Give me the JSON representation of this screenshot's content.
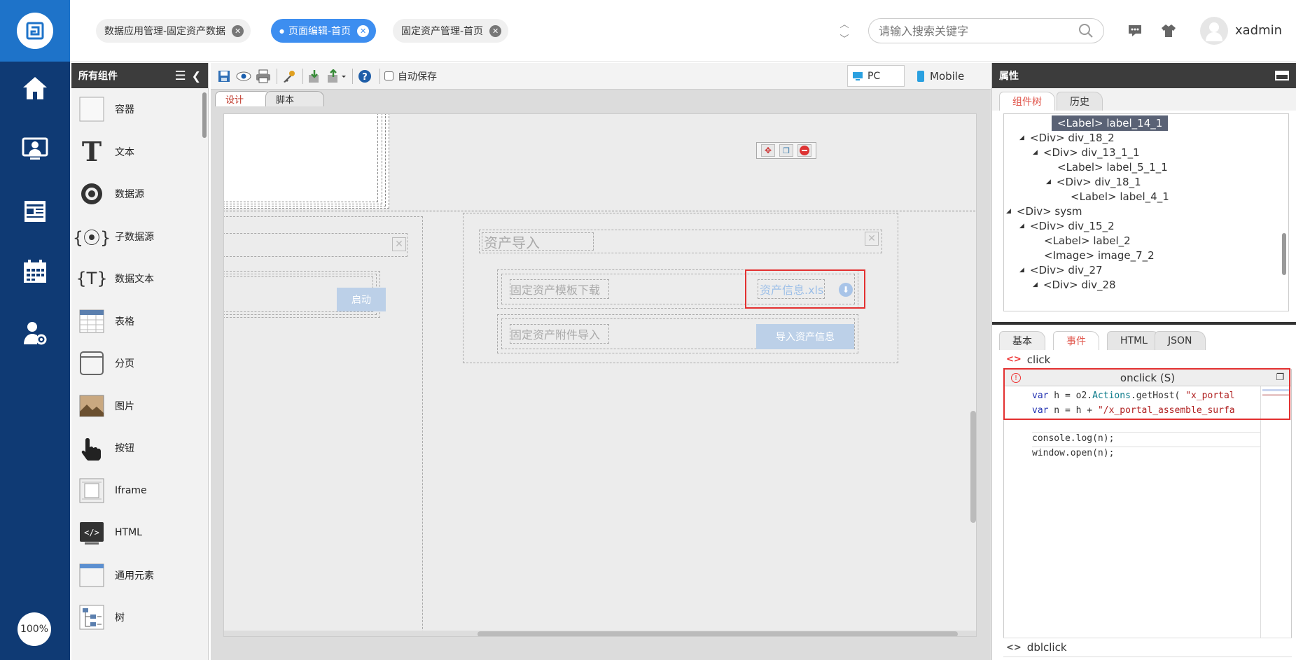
{
  "nav": {
    "items": [
      "home-icon",
      "monitor-user-icon",
      "news-icon",
      "calendar-icon",
      "user-settings-icon"
    ],
    "zoom": "100%"
  },
  "header": {
    "tabs": [
      {
        "label": "数据应用管理-固定资产数据",
        "active": false
      },
      {
        "label": "页面编辑-首页",
        "active": true
      },
      {
        "label": "固定资产管理-首页",
        "active": false
      }
    ],
    "search_placeholder": "请输入搜索关键字",
    "username": "xadmin"
  },
  "components": {
    "title": "所有组件",
    "items": [
      "容器",
      "文本",
      "数据源",
      "子数据源",
      "数据文本",
      "表格",
      "分页",
      "图片",
      "按钮",
      "Iframe",
      "HTML",
      "通用元素",
      "树"
    ]
  },
  "designer": {
    "autosave_label": "自动保存",
    "device_pc": "PC",
    "device_mobile": "Mobile",
    "tab_design": "设计",
    "tab_script": "脚本",
    "canvas": {
      "start_button": "启动",
      "asset_import_title": "资产导入",
      "template_download": "固定资产模板下载",
      "asset_file": "资产信息.xls",
      "attachment_import": "固定资产附件导入",
      "import_button": "导入资产信息"
    }
  },
  "props": {
    "title": "属性",
    "tabs_top": [
      "组件树",
      "历史"
    ],
    "tree": [
      {
        "label": "<Label> label_14_1",
        "depth": 4,
        "arrow": false,
        "selected": true
      },
      {
        "label": "<Div> div_18_2",
        "depth": 2,
        "arrow": true
      },
      {
        "label": "<Div> div_13_1_1",
        "depth": 3,
        "arrow": true
      },
      {
        "label": "<Label> label_5_1_1",
        "depth": 4,
        "arrow": false
      },
      {
        "label": "<Div> div_18_1",
        "depth": 4,
        "arrow": true
      },
      {
        "label": "<Label> label_4_1",
        "depth": 5,
        "arrow": false
      },
      {
        "label": "<Div> sysm",
        "depth": 1,
        "arrow": true
      },
      {
        "label": "<Div> div_15_2",
        "depth": 2,
        "arrow": true
      },
      {
        "label": "<Label> label_2",
        "depth": 3,
        "arrow": false
      },
      {
        "label": "<Image> image_7_2",
        "depth": 3,
        "arrow": false
      },
      {
        "label": "<Div> div_27",
        "depth": 2,
        "arrow": true
      },
      {
        "label": "<Div> div_28",
        "depth": 3,
        "arrow": true
      }
    ],
    "tabs_bottom": [
      "基本",
      "事件",
      "HTML",
      "JSON"
    ],
    "event_click": "click",
    "onclick_title": "onclick (S)",
    "code_lines": [
      "var h = o2.Actions.getHost( \"x_portal",
      "var n = h + \"/x_portal_assemble_surfa",
      "",
      "console.log(n);",
      "window.open(n);"
    ],
    "event_dblclick": "dblclick"
  }
}
